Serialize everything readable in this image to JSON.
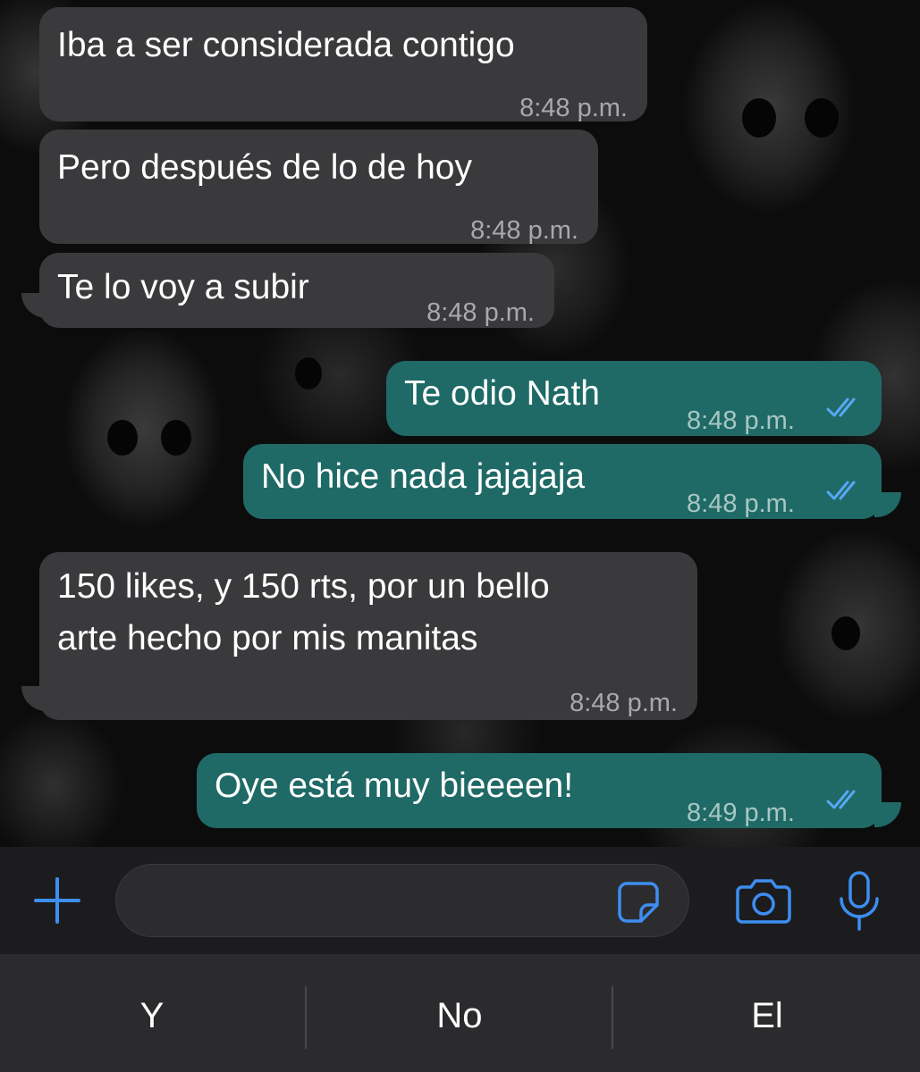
{
  "messages": [
    {
      "direction": "incoming",
      "text": "Iba a ser considerada contigo",
      "time": "8:48 p.m."
    },
    {
      "direction": "incoming",
      "text": "Pero después de lo de hoy",
      "time": "8:48 p.m."
    },
    {
      "direction": "incoming",
      "text": "Te lo voy a subir",
      "time": "8:48 p.m."
    },
    {
      "direction": "outgoing",
      "text": "Te odio Nath",
      "time": "8:48 p.m.",
      "status": "read"
    },
    {
      "direction": "outgoing",
      "text": "No hice nada jajajaja",
      "time": "8:48 p.m.",
      "status": "read"
    },
    {
      "direction": "incoming",
      "lines": [
        "150 likes, y 150 rts, por un bello",
        "arte hecho por mis manitas"
      ],
      "time": "8:48 p.m."
    },
    {
      "direction": "outgoing",
      "text": "Oye está muy bieeeen!",
      "time": "8:49 p.m.",
      "status": "read"
    }
  ],
  "input_bar": {
    "icons": [
      "plus-icon",
      "sticker-icon",
      "camera-icon",
      "microphone-icon"
    ],
    "placeholder": ""
  },
  "suggestions": [
    "Y",
    "No",
    "El"
  ],
  "colors": {
    "incoming_bubble": "#3a3a3c",
    "outgoing_bubble": "#1f6a66",
    "accent": "#3d8ef0",
    "read_ticks": "#56a8f5"
  }
}
